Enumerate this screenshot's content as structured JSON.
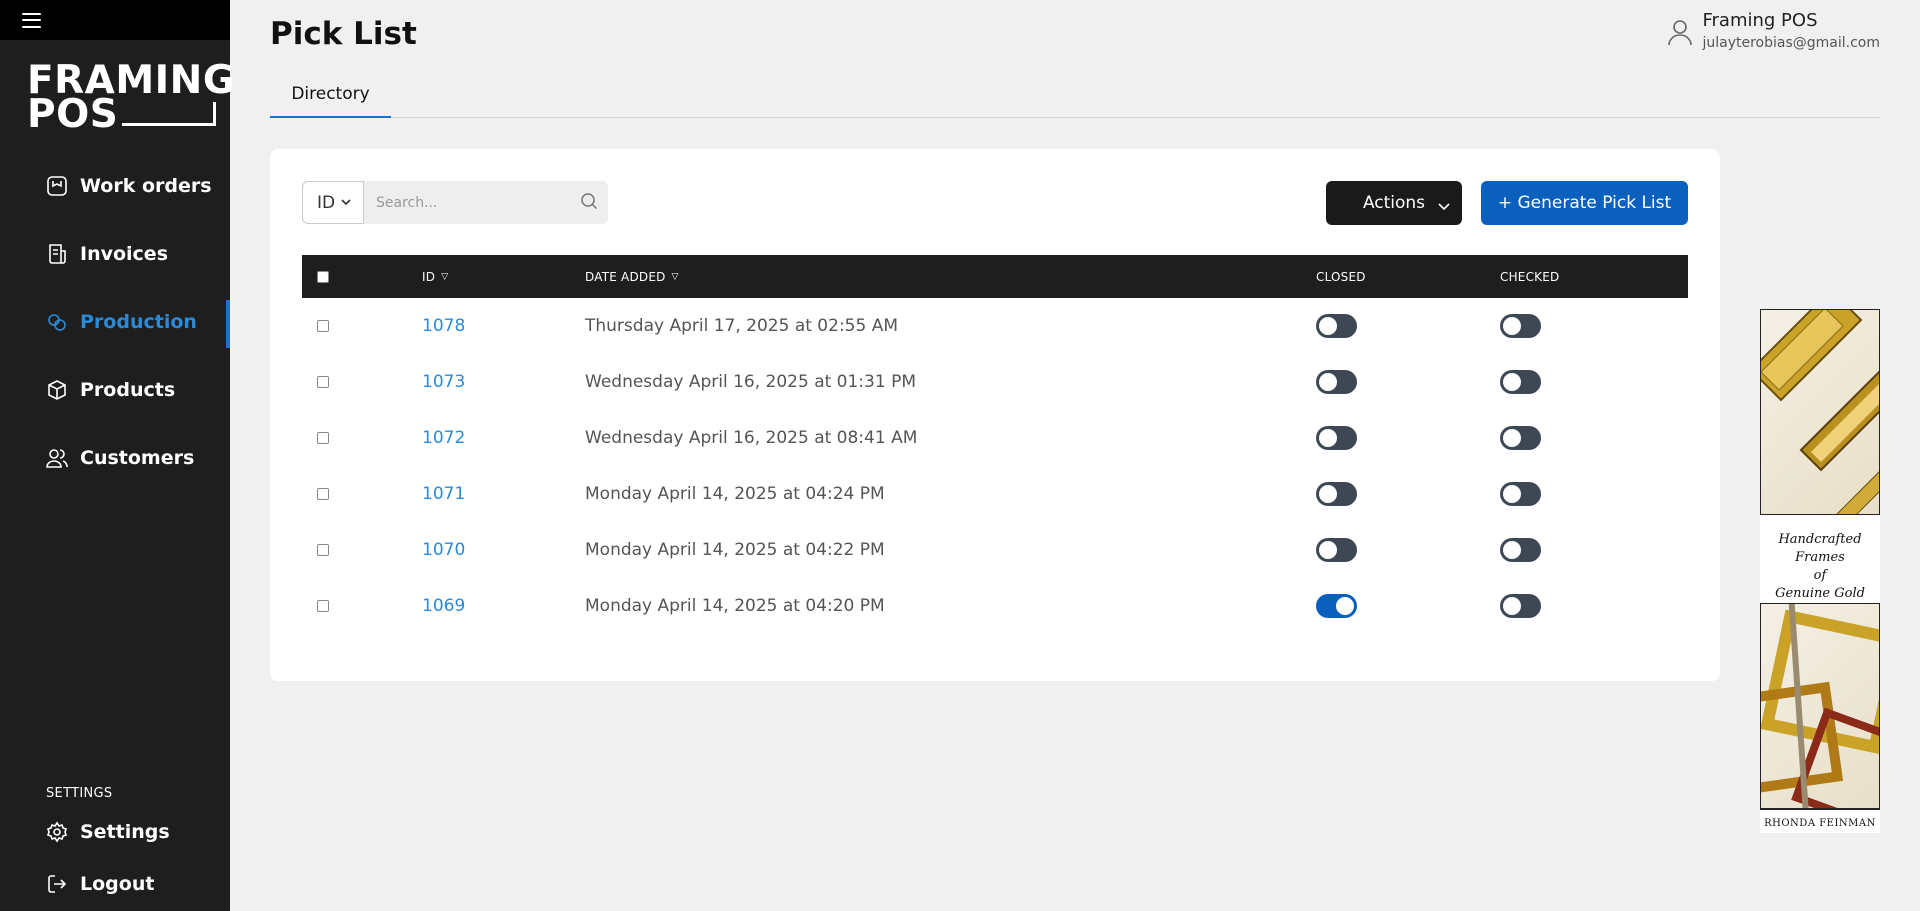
{
  "sidebar": {
    "logo_line1": "FRAMING",
    "logo_line2": "POS",
    "items": [
      {
        "label": "Work orders",
        "icon": "work-orders-icon"
      },
      {
        "label": "Invoices",
        "icon": "invoice-icon"
      },
      {
        "label": "Production",
        "icon": "production-icon",
        "active": true
      },
      {
        "label": "Products",
        "icon": "box-icon"
      },
      {
        "label": "Customers",
        "icon": "users-icon"
      }
    ],
    "settings_heading": "SETTINGS",
    "settings_label": "Settings",
    "logout_label": "Logout"
  },
  "header": {
    "title": "Pick List",
    "user_name": "Framing POS",
    "user_email": "julayterobias@gmail.com"
  },
  "tabs": [
    {
      "label": "Directory",
      "active": true
    }
  ],
  "toolbar": {
    "filter_select": "ID",
    "search_placeholder": "Search...",
    "actions_label": "Actions",
    "generate_label": "+ Generate Pick List"
  },
  "table": {
    "columns": {
      "id": "ID",
      "date": "DATE ADDED",
      "closed": "CLOSED",
      "checked": "CHECKED"
    },
    "rows": [
      {
        "id": "1078",
        "date": "Thursday April 17, 2025 at 02:55 AM",
        "closed": false,
        "checked": false
      },
      {
        "id": "1073",
        "date": "Wednesday April 16, 2025 at 01:31 PM",
        "closed": false,
        "checked": false
      },
      {
        "id": "1072",
        "date": "Wednesday April 16, 2025 at 08:41 AM",
        "closed": false,
        "checked": false
      },
      {
        "id": "1071",
        "date": "Monday April 14, 2025 at 04:24 PM",
        "closed": false,
        "checked": false
      },
      {
        "id": "1070",
        "date": "Monday April 14, 2025 at 04:22 PM",
        "closed": false,
        "checked": false
      },
      {
        "id": "1069",
        "date": "Monday April 14, 2025 at 04:20 PM",
        "closed": true,
        "checked": false
      }
    ]
  },
  "ad": {
    "text_line1": "Handcrafted Frames",
    "text_line2": "of",
    "text_line3": "Genuine Gold Leaf",
    "footer": "RHONDA FEINMAN"
  },
  "colors": {
    "accent": "#0b5fbd",
    "link": "#2b8ad8",
    "sidebar_bg": "#1e1e1e",
    "toggle_off": "#3e4754"
  }
}
